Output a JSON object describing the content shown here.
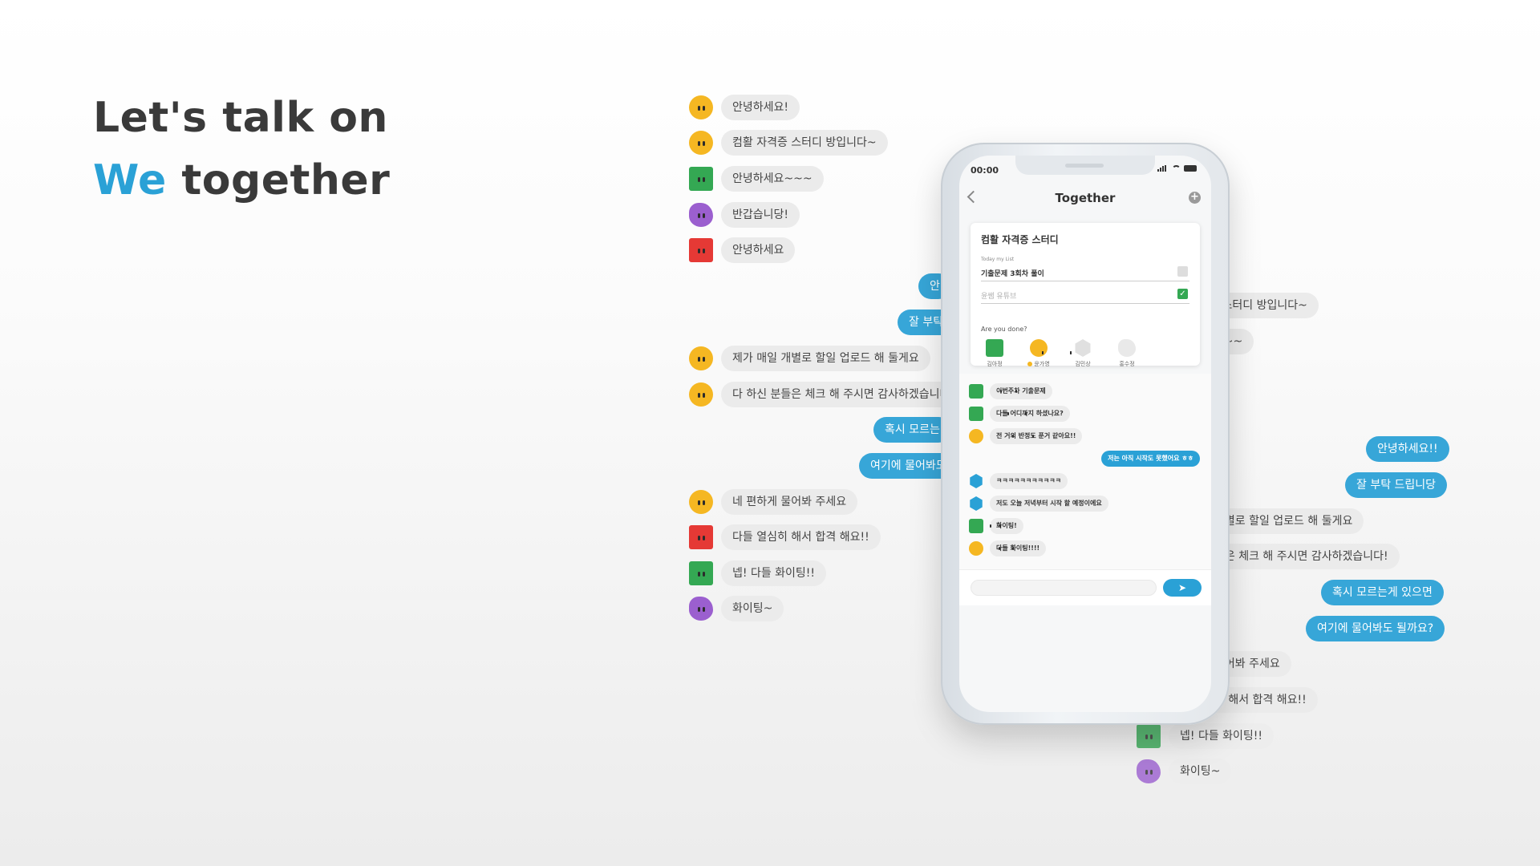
{
  "hero": {
    "line1": "Let's talk on",
    "accent": "We",
    "rest": " together"
  },
  "left_chat": [
    {
      "text": "안녕하세요!"
    },
    {
      "text": "컴활 자격증 스터디 방입니다~"
    },
    {
      "text": "안녕하세요~~~"
    },
    {
      "text": "반갑습니당!"
    },
    {
      "text": "안녕하세요"
    },
    {
      "text": "안"
    },
    {
      "text": "잘 부탁"
    },
    {
      "text": "제가 매일 개별로 할일 업로드 해 둘게요"
    },
    {
      "text": "다 하신 분들은 체크 해 주시면 감사하겠습니다"
    },
    {
      "text": "혹시 모르는"
    },
    {
      "text": "여기에 물어봐도"
    },
    {
      "text": "네 편하게 물어봐 주세요"
    },
    {
      "text": "다들 열심히 해서 합격 해요!!"
    },
    {
      "text": "넵! 다들 화이팅!!"
    },
    {
      "text": "화이팅~"
    }
  ],
  "right_chat": [
    {
      "text": "!"
    },
    {
      "text": "- 스터디 방입니다~"
    },
    {
      "text": "~~~"
    },
    {
      "text": "!"
    },
    {
      "text": ""
    },
    {
      "text": "안녕하세요!!"
    },
    {
      "text": "잘 부탁 드립니당"
    },
    {
      "text": "개별로 할일 업로드 해 둘게요"
    },
    {
      "text": "들은 체크 해 주시면 감사하겠습니다!"
    },
    {
      "text": "혹시 모르는게 있으면"
    },
    {
      "text": "여기에 물어봐도 될까요?"
    },
    {
      "text": "물어봐 주세요"
    },
    {
      "text": "히 해서 합격 해요!!"
    },
    {
      "text": "넵! 다들 화이팅!!"
    },
    {
      "text": "화이팅~"
    }
  ],
  "phone": {
    "status_time": "00:00",
    "title": "Together",
    "card": {
      "title": "컴활 자격증 스터디",
      "subtitle": "Today my List",
      "todos": [
        {
          "text": "기출문제 3회차 풀이",
          "checked": false
        },
        {
          "text": "윤쌤 유튜브",
          "checked": true
        }
      ],
      "question": "Are you done?",
      "members": [
        {
          "name": "김아정",
          "color": "#34a853"
        },
        {
          "name": "윤가영",
          "color": "#f5b722"
        },
        {
          "name": "김민상",
          "color": "#e0e0e0"
        },
        {
          "name": "홍수정",
          "color": "#e9e9e9"
        }
      ]
    },
    "messages": [
      {
        "text": "이번주차 기출문제"
      },
      {
        "text": "다들 어디까지 하셨나요?"
      },
      {
        "text": "전 거의 반정도 푼거 같아요!!"
      },
      {
        "text": "저는 아직 시작도 못했어요 ㅎㅎ"
      },
      {
        "text": "ㅋㅋㅋㅋㅋㅋㅋㅋㅋㅋㅋ"
      },
      {
        "text": "저도 오늘 저녁부터 시작 할 예정이에요"
      },
      {
        "text": "화이팅!"
      },
      {
        "text": "다들 화이팅!!!!"
      }
    ],
    "send_icon": "paper-plane-icon"
  }
}
